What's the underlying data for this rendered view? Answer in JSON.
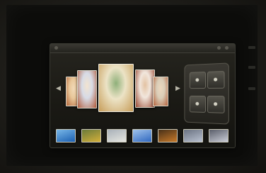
{
  "window": {
    "title": ""
  },
  "icons": {
    "prev": "chevron-left-icon",
    "next": "chevron-right-icon",
    "controls": [
      "rotate-icon",
      "info-icon",
      "slideshow-icon",
      "delete-icon"
    ]
  },
  "colors": {
    "screen_background": "#0c0c0a",
    "window_background": "#1a1914",
    "accent": "#d9d6c8"
  },
  "carousel": {
    "photos": [
      {
        "colors": [
          "#e8c79a",
          "#b4673b",
          "#f1d9b7"
        ]
      },
      {
        "colors": [
          "#d7dbe6",
          "#b05a3a",
          "#f2e3cf"
        ]
      },
      {
        "colors": [
          "#ece3c6",
          "#c79d59",
          "#8fb07a"
        ]
      },
      {
        "colors": [
          "#f1e6dc",
          "#9c4a34",
          "#e3c2a2"
        ]
      },
      {
        "colors": [
          "#d9cdb8",
          "#b4623c",
          "#ecd7bd"
        ]
      }
    ]
  },
  "filmstrip": {
    "thumbs": [
      {
        "colors": [
          "#1b5fb0",
          "#78b7e8"
        ]
      },
      {
        "colors": [
          "#d4b03a",
          "#6a7a3a"
        ]
      },
      {
        "colors": [
          "#e6e6e0",
          "#a9b1b9"
        ]
      },
      {
        "colors": [
          "#2f68c0",
          "#9fc2ea"
        ]
      },
      {
        "colors": [
          "#c87a2a",
          "#473018"
        ]
      },
      {
        "colors": [
          "#b9c1d0",
          "#6b7382"
        ]
      },
      {
        "colors": [
          "#c9ccd6",
          "#5a5e6a"
        ]
      }
    ]
  }
}
